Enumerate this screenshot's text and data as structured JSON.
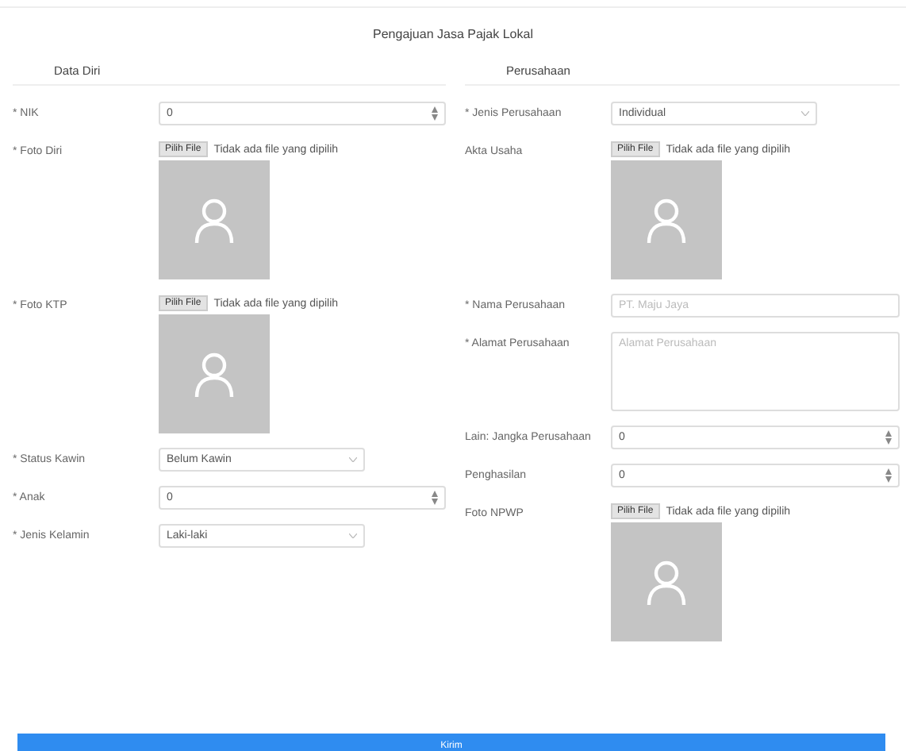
{
  "title": "Pengajuan Jasa Pajak Lokal",
  "sections": [
    {
      "heading": "Data Diri",
      "fields": [
        {
          "kind": "number",
          "label": "* NIK",
          "value": "0"
        },
        {
          "kind": "image",
          "label": "* Foto Diri",
          "button": "Pilih File",
          "file_status": "Tidak ada file yang dipilih"
        },
        {
          "kind": "image",
          "label": "* Foto KTP",
          "button": "Pilih File",
          "file_status": "Tidak ada file yang dipilih"
        },
        {
          "kind": "select",
          "label": "* Status Kawin",
          "value": "Belum Kawin"
        },
        {
          "kind": "number",
          "label": "* Anak",
          "value": "0"
        },
        {
          "kind": "select",
          "label": "* Jenis Kelamin",
          "value": "Laki-laki"
        }
      ]
    },
    {
      "heading": "Perusahaan",
      "fields": [
        {
          "kind": "select",
          "label": "* Jenis Perusahaan",
          "value": "Individual"
        },
        {
          "kind": "image",
          "label": "Akta Usaha",
          "button": "Pilih File",
          "file_status": "Tidak ada file yang dipilih"
        },
        {
          "kind": "text",
          "label": "* Nama Perusahaan",
          "placeholder": "PT. Maju Jaya"
        },
        {
          "kind": "textarea",
          "label": "* Alamat Perusahaan",
          "placeholder": "Alamat Perusahaan"
        },
        {
          "kind": "number",
          "label": "Lain: Jangka Perusahaan",
          "value": "0"
        },
        {
          "kind": "number",
          "label": "Penghasilan",
          "value": "0"
        },
        {
          "kind": "image",
          "label": "Foto NPWP",
          "button": "Pilih File",
          "file_status": "Tidak ada file yang dipilih"
        }
      ]
    }
  ],
  "submit": "Kirim"
}
